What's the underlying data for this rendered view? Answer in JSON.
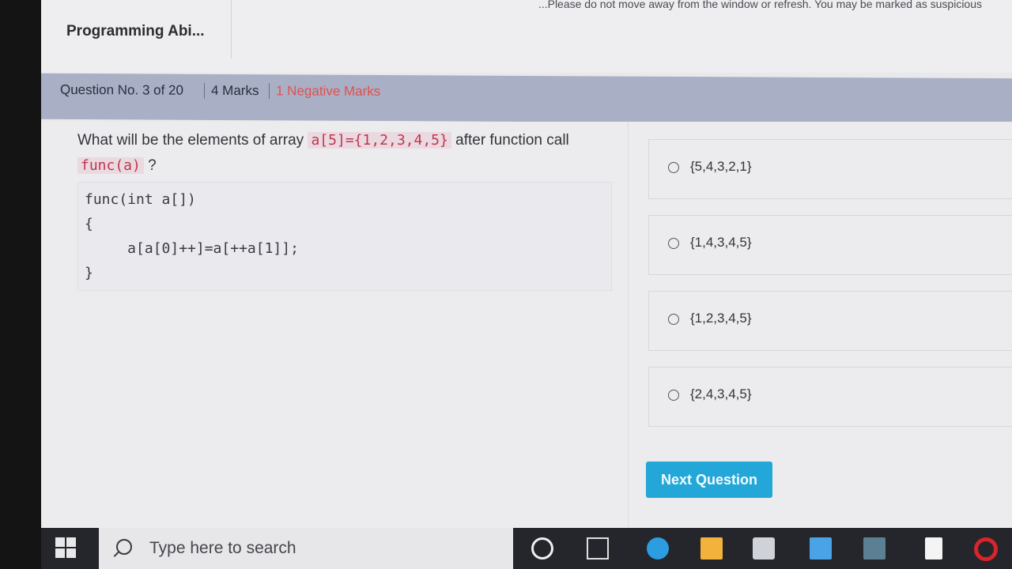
{
  "warning": "...Please do not move away from the window or refresh. You may be marked as suspicious",
  "exam": {
    "title": "Programming Abi..."
  },
  "question_bar": {
    "number": "Question No. 3 of 20",
    "marks": "4 Marks",
    "negative": "1 Negative Marks"
  },
  "question": {
    "text_before": "What will be the elements of array ",
    "array_code": "a[5]={1,2,3,4,5}",
    "text_middle": " after function call ",
    "call_code": "func(a)",
    "text_after": " ?",
    "code": "func(int a[])\n{\n     a[a[0]++]=a[++a[1]];\n}"
  },
  "options": [
    "{5,4,3,2,1}",
    "{1,4,3,4,5}",
    "{1,2,3,4,5}",
    "{2,4,3,4,5}"
  ],
  "next_button": "Next Question",
  "taskbar": {
    "search_placeholder": "Type here to search",
    "icons": [
      "start-icon",
      "search-icon",
      "cortana-icon",
      "task-view-icon",
      "edge-icon",
      "file-explorer-icon",
      "store-icon",
      "mail-icon",
      "photos-icon",
      "file-icon",
      "opera-icon"
    ]
  },
  "colors": {
    "accent": "#23a7d8",
    "negative": "#e3504f",
    "code": "#c1354d"
  }
}
